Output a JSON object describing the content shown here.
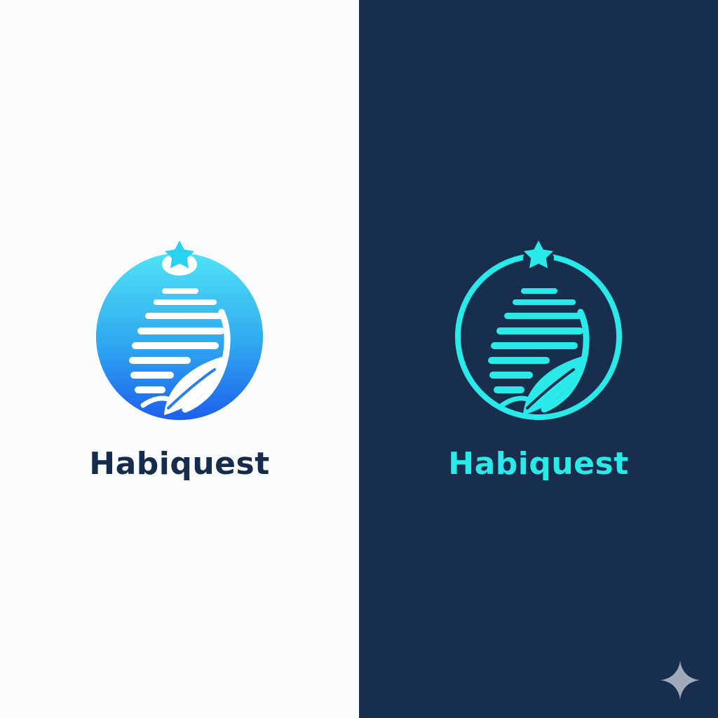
{
  "logos": [
    {
      "variant": "light",
      "wordmark": "Habiquest",
      "background": "#fafbfc",
      "text_color": "#152c4c",
      "icon": "globe-star-leaf-icon"
    },
    {
      "variant": "dark",
      "wordmark": "Habiquest",
      "background": "#172f4d",
      "text_color": "#29eae9",
      "icon": "globe-star-leaf-icon"
    }
  ],
  "colors": {
    "gradient_top": "#45ddf4",
    "gradient_bottom": "#1d63ee",
    "cyan_accent": "#29eae9"
  },
  "corner_icon": "sparkle-icon"
}
